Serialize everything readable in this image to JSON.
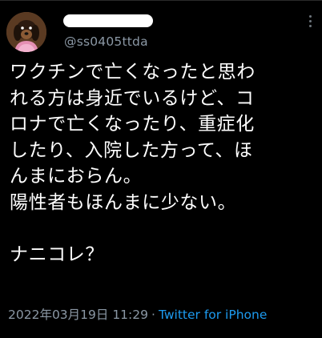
{
  "author": {
    "handle": "@ss0405ttda",
    "avatar_icon": "dog-avatar-icon"
  },
  "tweet": {
    "text": "ワクチンで亡くなったと思わ\nれる方は身近でいるけど、コ\nロナで亡くなったり、重症化\nしたり、入院した方って、ほ\nんまにおらん。\n陽性者もほんまに少ない。\n\nナニコレ？",
    "timestamp": "2022年03月19日 11:29",
    "separator": "·",
    "source": "Twitter for iPhone"
  },
  "colors": {
    "background": "#000000",
    "text": "#ffffff",
    "muted": "#8b98a5",
    "link": "#1d9bf0"
  }
}
